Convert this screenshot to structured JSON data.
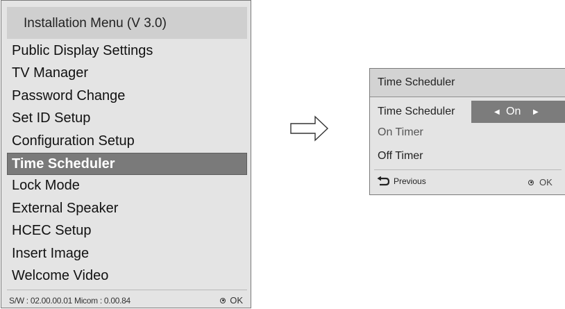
{
  "installation_menu": {
    "title": "Installation Menu (V 3.0)",
    "items": [
      {
        "label": "Public Display Settings",
        "selected": false
      },
      {
        "label": "TV Manager",
        "selected": false
      },
      {
        "label": "Password Change",
        "selected": false
      },
      {
        "label": "Set ID Setup",
        "selected": false
      },
      {
        "label": "Configuration Setup",
        "selected": false
      },
      {
        "label": "Time Scheduler",
        "selected": true
      },
      {
        "label": "Lock Mode",
        "selected": false
      },
      {
        "label": "External Speaker",
        "selected": false
      },
      {
        "label": "HCEC Setup",
        "selected": false
      },
      {
        "label": "Insert Image",
        "selected": false
      },
      {
        "label": "Welcome Video",
        "selected": false
      }
    ],
    "footer": {
      "sw_info": "S/W : 02.00.00.01 Micom : 0.00.84",
      "ok_label": "OK"
    }
  },
  "time_scheduler": {
    "title": "Time Scheduler",
    "rows": [
      {
        "label": "Time Scheduler",
        "value": "On"
      },
      {
        "label": "On Timer"
      },
      {
        "label": "Off Timer"
      }
    ],
    "footer": {
      "previous_label": "Previous",
      "ok_label": "OK"
    }
  },
  "icons": {
    "left_arrow": "arrow-left-icon",
    "right_arrow": "arrow-right-icon",
    "transition": "outline-arrow-icon",
    "back": "back-arrow-icon",
    "ok": "ok-dot-icon"
  },
  "colors": {
    "panel_bg": "#e4e4e4",
    "header_bg": "#cfcfcf",
    "selected_bg": "#7a7a7a",
    "selected_text": "#ffffff"
  }
}
